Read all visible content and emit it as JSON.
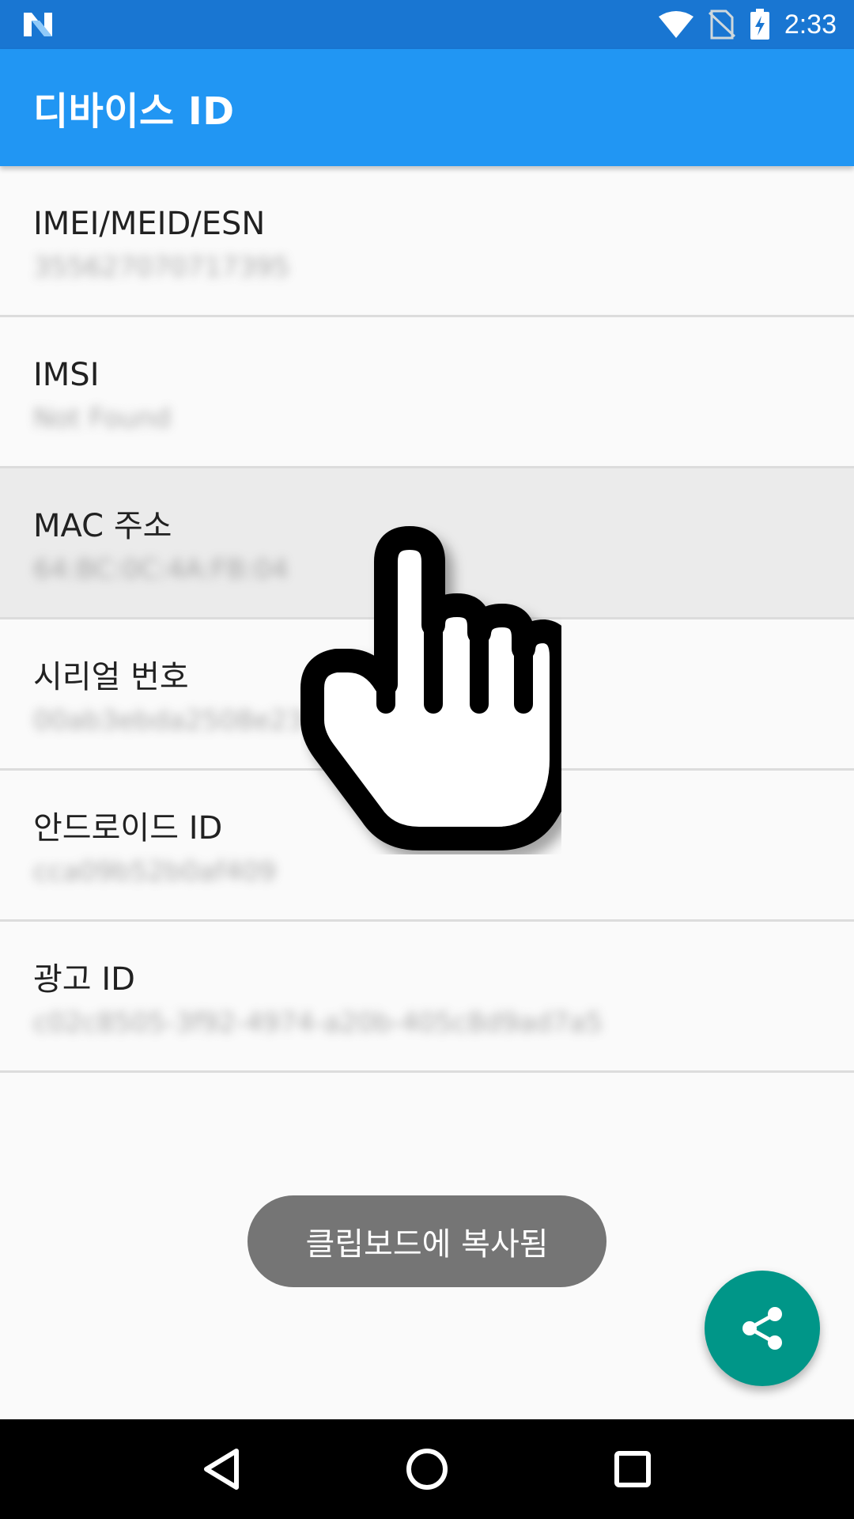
{
  "status_bar": {
    "time": "2:33",
    "icons": [
      "notification-n-icon",
      "wifi-icon",
      "no-sim-icon",
      "battery-charging-icon"
    ]
  },
  "app_bar": {
    "title": "디바이스 ID"
  },
  "items": [
    {
      "title": "IMEI/MEID/ESN",
      "value": "355627070717395"
    },
    {
      "title": "IMSI",
      "value": "Not Found"
    },
    {
      "title": "MAC 주소",
      "value": "64:BC:0C:4A:FB:04"
    },
    {
      "title": "시리얼 번호",
      "value": "00ab3ebda2508e23"
    },
    {
      "title": "안드로이드 ID",
      "value": "cca09b52b0af409"
    },
    {
      "title": "광고 ID",
      "value": "c02c8505-3f92-4974-a20b-405c8d9ad7a5"
    }
  ],
  "pressed_item_index": 2,
  "toast": {
    "text": "클립보드에 복사됨"
  },
  "fab": {
    "icon": "share-icon",
    "color": "#009688"
  },
  "nav_bar": {
    "icons": [
      "back-icon",
      "home-icon",
      "recents-icon"
    ]
  },
  "colors": {
    "status_bar": "#1976d2",
    "app_bar": "#2196f3",
    "accent": "#009688"
  }
}
